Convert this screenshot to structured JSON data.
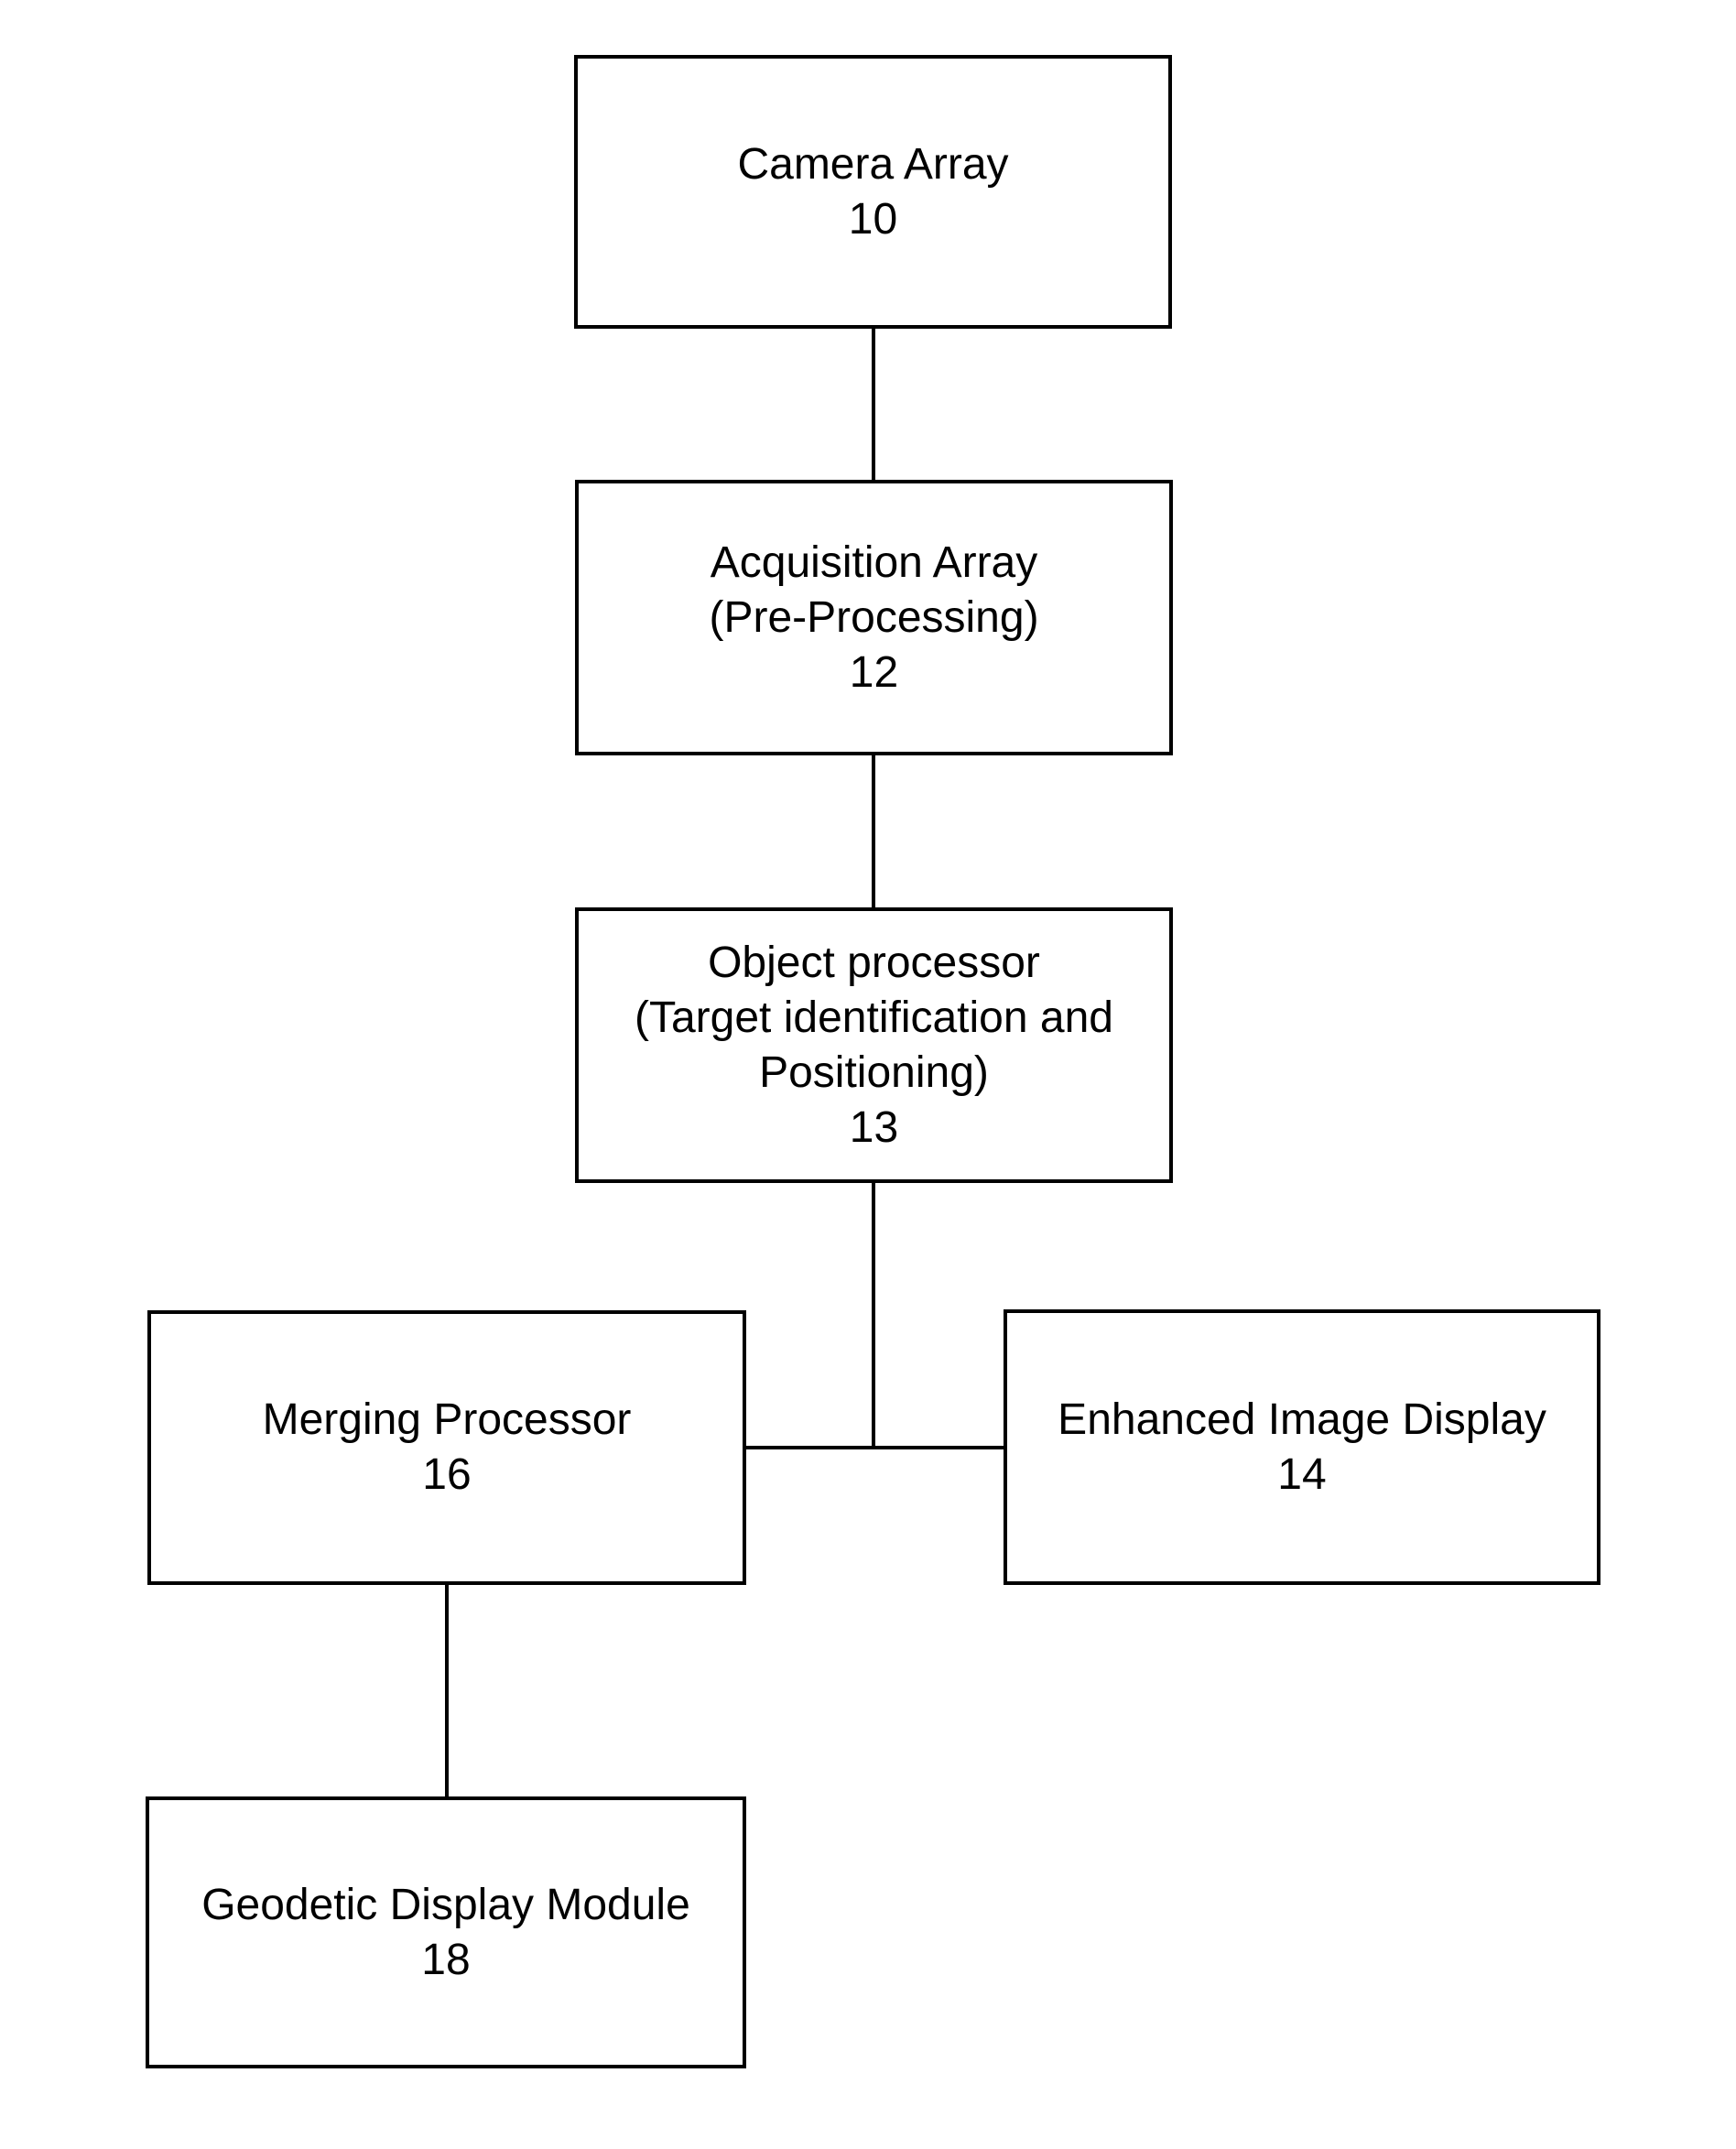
{
  "diagram": {
    "type": "block-diagram",
    "nodes": [
      {
        "id": "10",
        "lines": [
          "Camera Array",
          "10"
        ]
      },
      {
        "id": "12",
        "lines": [
          "Acquisition Array",
          "(Pre-Processing)",
          "12"
        ]
      },
      {
        "id": "13",
        "lines": [
          "Object processor",
          "(Target identification and",
          "Positioning)",
          "13"
        ]
      },
      {
        "id": "16",
        "lines": [
          "Merging Processor",
          "16"
        ]
      },
      {
        "id": "14",
        "lines": [
          "Enhanced Image Display",
          "14"
        ]
      },
      {
        "id": "18",
        "lines": [
          "Geodetic Display Module",
          "18"
        ]
      }
    ],
    "edges": [
      {
        "from": "10",
        "to": "12"
      },
      {
        "from": "12",
        "to": "13"
      },
      {
        "from": "13",
        "to": "16"
      },
      {
        "from": "13",
        "to": "14"
      },
      {
        "from": "16",
        "to": "18"
      }
    ]
  }
}
